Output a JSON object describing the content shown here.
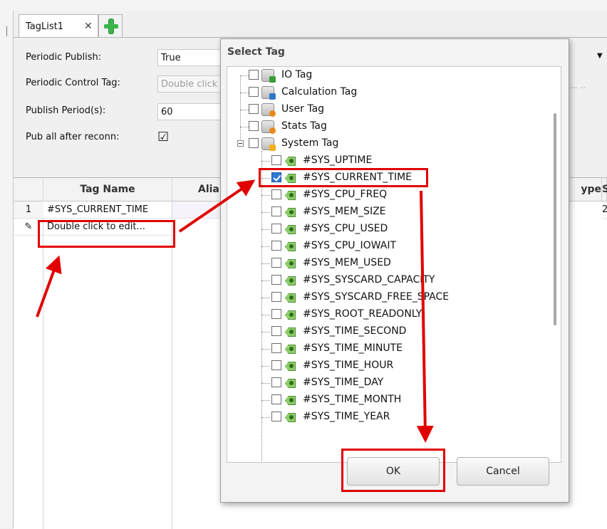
{
  "tabs": {
    "doc_tab_label": "TagList1",
    "close_glyph": "✕"
  },
  "properties": {
    "periodic_publish": {
      "label": "Periodic Publish:",
      "value": "True"
    },
    "periodic_control_tag": {
      "label": "Periodic Control Tag:",
      "value": "Double click"
    },
    "publish_period": {
      "label": "Publish Period(s):",
      "value": "60"
    },
    "pub_all_after_reconn": {
      "label": "Pub all after reconn:",
      "checked": true,
      "check_glyph": "☑"
    },
    "ellipsis": "...  .."
  },
  "grid": {
    "columns": [
      "Tag Name",
      "Alia",
      "ype",
      "S"
    ],
    "rows": [
      {
        "num": "1",
        "tag_name": "#SYS_CURRENT_TIME",
        "extra": "2"
      }
    ],
    "new_row": {
      "icon": "pencil-icon",
      "placeholder": "Double click to edit..."
    }
  },
  "dialog": {
    "title": "Select Tag",
    "tree": [
      {
        "label": "IO Tag",
        "icon": "io-db-icon"
      },
      {
        "label": "Calculation Tag",
        "icon": "calc-db-icon"
      },
      {
        "label": "User Tag",
        "icon": "user-db-icon"
      },
      {
        "label": "Stats Tag",
        "icon": "stats-db-icon"
      },
      {
        "label": "System Tag",
        "icon": "system-db-icon",
        "expanded": true,
        "children": [
          {
            "label": "#SYS_UPTIME",
            "checked": false
          },
          {
            "label": "#SYS_CURRENT_TIME",
            "checked": true
          },
          {
            "label": "#SYS_CPU_FREQ",
            "checked": false
          },
          {
            "label": "#SYS_MEM_SIZE",
            "checked": false
          },
          {
            "label": "#SYS_CPU_USED",
            "checked": false
          },
          {
            "label": "#SYS_CPU_IOWAIT",
            "checked": false
          },
          {
            "label": "#SYS_MEM_USED",
            "checked": false
          },
          {
            "label": "#SYS_SYSCARD_CAPACITY",
            "checked": false
          },
          {
            "label": "#SYS_SYSCARD_FREE_SPACE",
            "checked": false
          },
          {
            "label": "#SYS_ROOT_READONLY",
            "checked": false
          },
          {
            "label": "#SYS_TIME_SECOND",
            "checked": false
          },
          {
            "label": "#SYS_TIME_MINUTE",
            "checked": false
          },
          {
            "label": "#SYS_TIME_HOUR",
            "checked": false
          },
          {
            "label": "#SYS_TIME_DAY",
            "checked": false
          },
          {
            "label": "#SYS_TIME_MONTH",
            "checked": false
          },
          {
            "label": "#SYS_TIME_YEAR",
            "checked": false
          }
        ]
      }
    ],
    "ok_label": "OK",
    "cancel_label": "Cancel"
  },
  "colors": {
    "annotation_red": "#e00000",
    "check_blue": "#2f78d4",
    "tag_green": "#8dcc6a"
  }
}
